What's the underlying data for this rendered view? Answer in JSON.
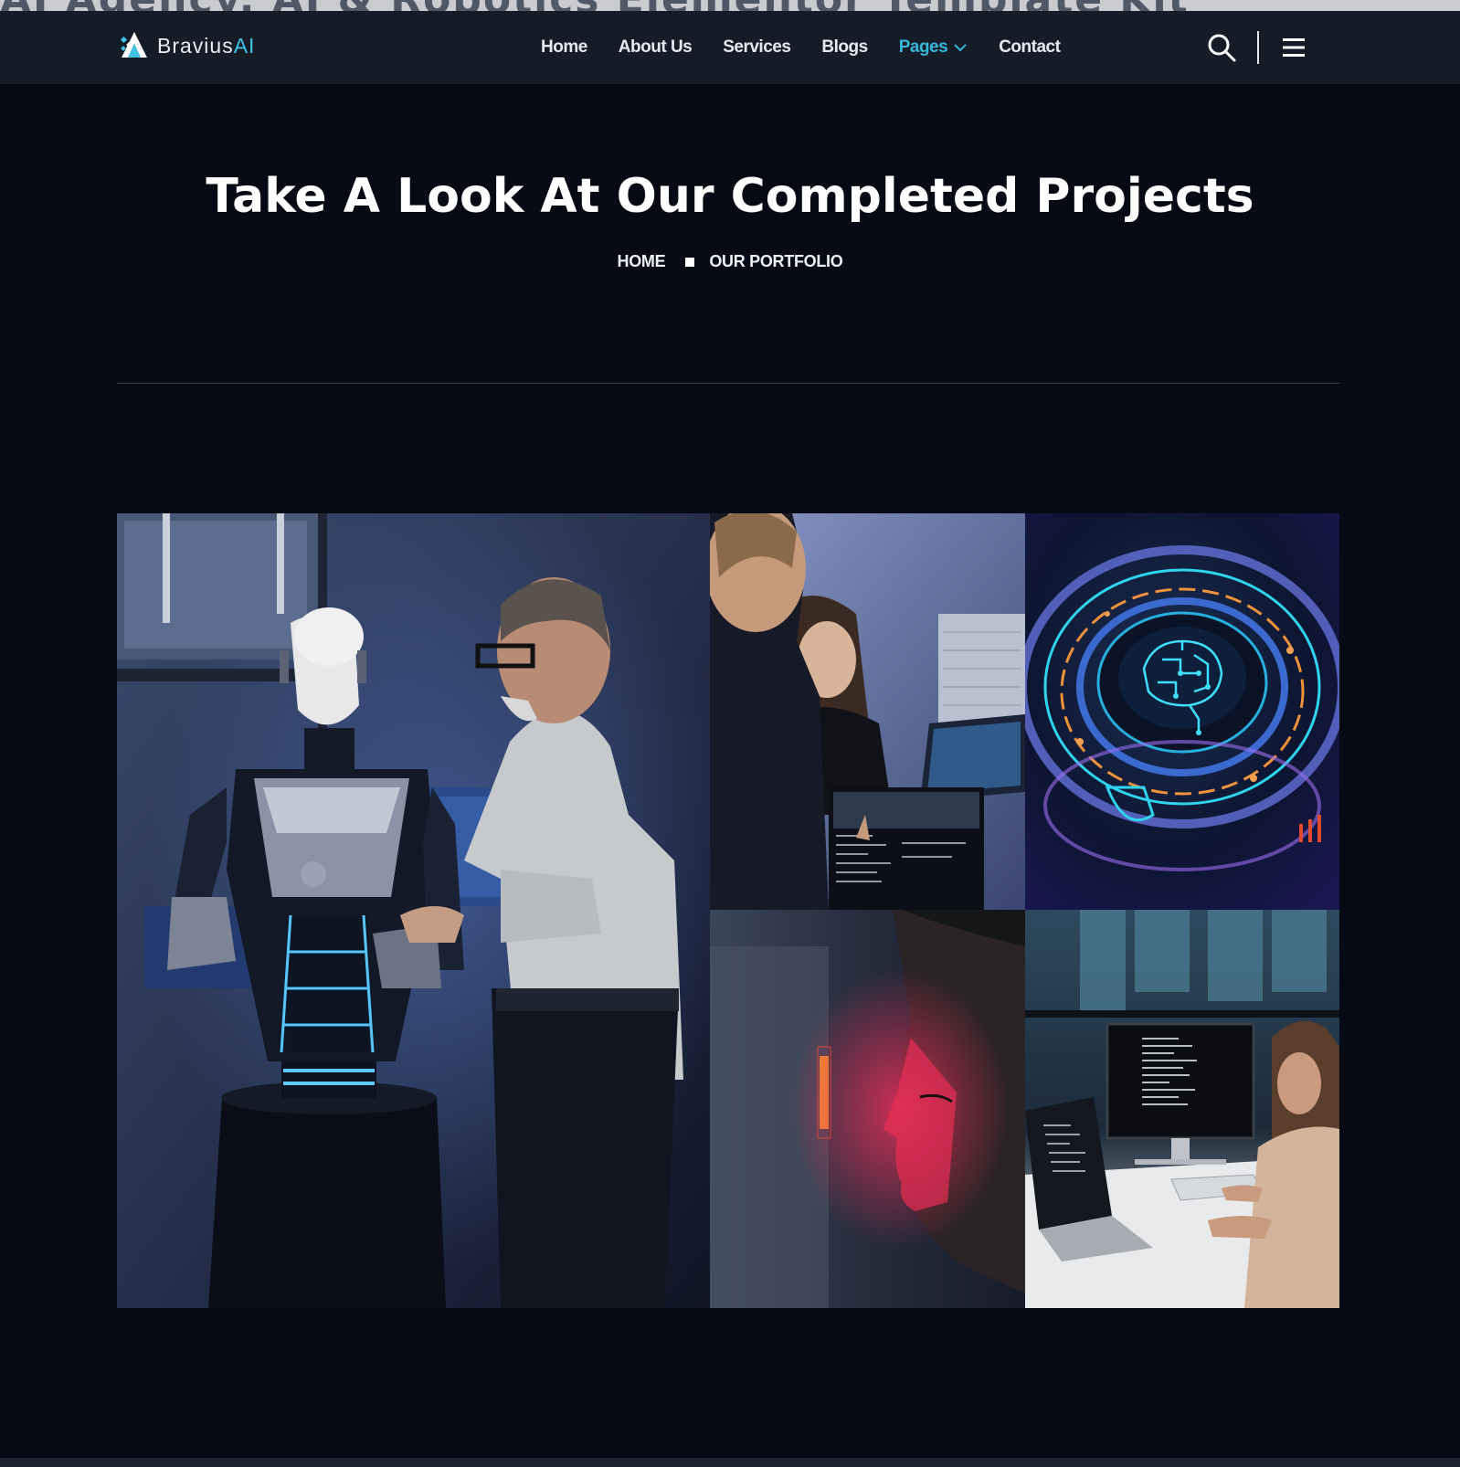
{
  "overlay_title": "AI Agency, AI & Robotics Elementor Template Kit",
  "brand": {
    "name": "Bravius",
    "accent": "AI"
  },
  "nav": {
    "items": [
      {
        "label": "Home"
      },
      {
        "label": "About Us"
      },
      {
        "label": "Services"
      },
      {
        "label": "Blogs"
      },
      {
        "label": "Pages",
        "active": true,
        "has_dropdown": true
      },
      {
        "label": "Contact"
      }
    ]
  },
  "header_icons": [
    "search-icon",
    "hamburger-menu-icon"
  ],
  "hero": {
    "title": "Take A Look At Our Completed Projects",
    "breadcrumb": {
      "home": "HOME",
      "current": "OUR PORTFOLIO"
    }
  },
  "gallery": {
    "images": [
      "robot-engineer-photo",
      "team-reviewing-data-photo",
      "circuit-brain-hologram-photo",
      "face-scan-red-light-photo",
      "developer-coding-photo"
    ]
  },
  "colors": {
    "background": "#060a14",
    "header": "#151b27",
    "accent": "#36b7da",
    "text": "#ffffff"
  }
}
